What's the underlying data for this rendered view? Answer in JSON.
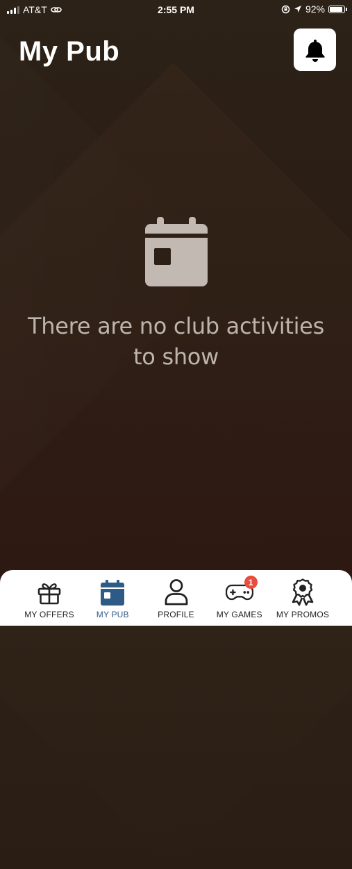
{
  "status_bar": {
    "carrier": "AT&T",
    "time": "2:55 PM",
    "battery": "92%",
    "battery_level": 0.92
  },
  "header": {
    "title": "My Pub",
    "bell_icon": "bell-icon"
  },
  "empty_state": {
    "icon": "calendar-icon",
    "message": "There are no club activities to show"
  },
  "tab_bar": {
    "active_tab": "my_pub",
    "active_color": "#2e5a88",
    "badge_color": "#e74c3c",
    "items": [
      {
        "label": "MY OFFERS",
        "icon": "gift-icon"
      },
      {
        "label": "MY PUB",
        "icon": "calendar-icon"
      },
      {
        "label": "PROFILE",
        "icon": "person-icon"
      },
      {
        "label": "MY GAMES",
        "icon": "gamepad-icon",
        "badge": "1"
      },
      {
        "label": "MY PROMOS",
        "icon": "award-icon"
      }
    ]
  }
}
